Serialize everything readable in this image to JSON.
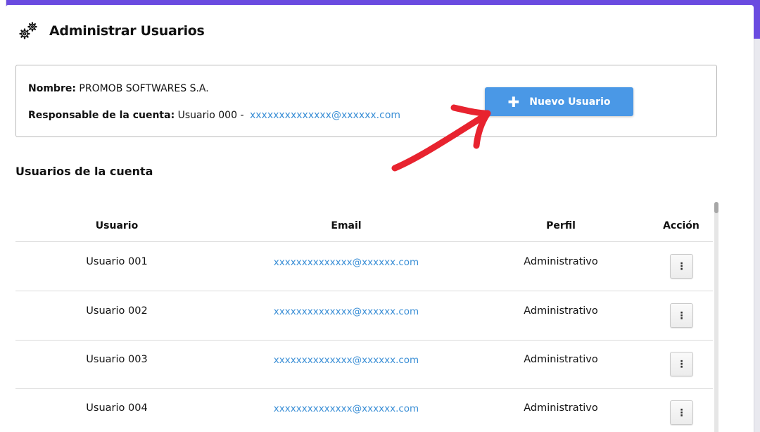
{
  "header": {
    "title": "Administrar Usuarios",
    "icon": "gears-icon"
  },
  "account": {
    "name_label": "Nombre:",
    "name_value": "PROMOB SOFTWARES S.A.",
    "owner_label": "Responsable de la cuenta:",
    "owner_value": "Usuario 000 -",
    "owner_email": "xxxxxxxxxxxxxx@xxxxxx.com"
  },
  "new_user_button": {
    "label": "Nuevo Usuario",
    "icon": "plus-icon"
  },
  "users_section": {
    "title": "Usuarios de la cuenta",
    "columns": [
      "Usuario",
      "Email",
      "Perfil",
      "Acción"
    ],
    "rows": [
      {
        "user": "Usuario 001",
        "email": "xxxxxxxxxxxxxx@xxxxxx.com",
        "profile": "Administrativo"
      },
      {
        "user": "Usuario 002",
        "email": "xxxxxxxxxxxxxx@xxxxxx.com",
        "profile": "Administrativo"
      },
      {
        "user": "Usuario 003",
        "email": "xxxxxxxxxxxxxx@xxxxxx.com",
        "profile": "Administrativo"
      },
      {
        "user": "Usuario 004",
        "email": "xxxxxxxxxxxxxx@xxxxxx.com",
        "profile": "Administrativo"
      }
    ],
    "action_icon": "kebab-menu-icon"
  },
  "colors": {
    "accent": "#4a98e6",
    "link": "#3b8fd6",
    "arrow": "#e8232f",
    "frame": "#6a4be0"
  }
}
